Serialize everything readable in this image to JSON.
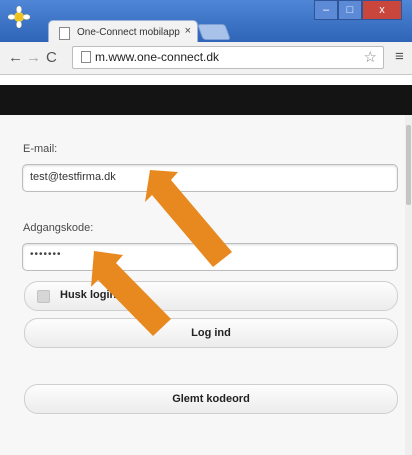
{
  "browser": {
    "tab_title": "One-Connect mobilapp",
    "tab_close": "×",
    "url": "m.www.one-connect.dk",
    "window_buttons": {
      "minimize": "–",
      "maximize": "□",
      "close": "x"
    }
  },
  "form": {
    "email_label": "E-mail:",
    "email_value": "test@testfirma.dk",
    "password_label": "Adgangskode:",
    "password_value": "•••••••",
    "remember_label": "Husk login",
    "login_button": "Log ind",
    "forgot_button": "Glemt kodeord"
  },
  "colors": {
    "arrow": "#e8891f",
    "header_bar": "#141414",
    "chrome_blue": "#3b73c4"
  }
}
